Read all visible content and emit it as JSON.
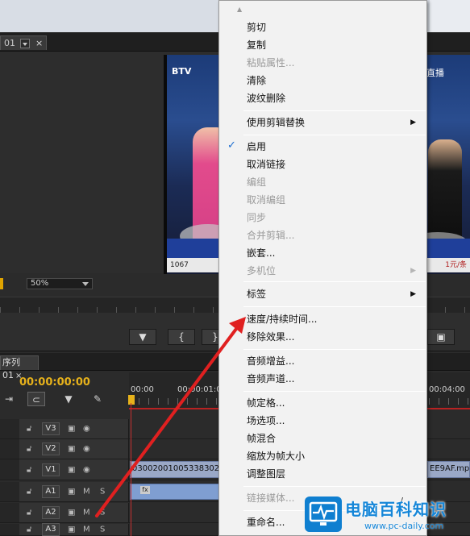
{
  "program_panel": {
    "tab_label": "01",
    "close": "×",
    "zoom_value": "50%"
  },
  "video": {
    "channel_logo": "BTV",
    "live_label": "直播",
    "ticker_left": "1067",
    "ticker_price": "1元/条"
  },
  "transport": {
    "buttons": [
      "▼",
      "{",
      "}"
    ]
  },
  "timeline": {
    "tab_label": "序列 01",
    "tab_close": "×",
    "timecode": "00:00:00:00",
    "ruler_labels": [
      "00:00",
      "00:00:01:00",
      "00:04:00"
    ],
    "tracks": [
      {
        "name": "V3"
      },
      {
        "name": "V2"
      },
      {
        "name": "V1"
      },
      {
        "name": "A1",
        "m": "M",
        "s": "S"
      },
      {
        "name": "A2",
        "m": "M",
        "s": "S"
      },
      {
        "name": "A3",
        "m": "M",
        "s": "S"
      }
    ],
    "clip_v1_left": "03002001005338302B",
    "clip_v1_right": "EE9AF.mp4",
    "fx_badge": "fx"
  },
  "context_menu": {
    "items": [
      {
        "label": "剪切",
        "enabled": true
      },
      {
        "label": "复制",
        "enabled": true
      },
      {
        "label": "粘贴属性...",
        "enabled": false
      },
      {
        "label": "清除",
        "enabled": true
      },
      {
        "label": "波纹删除",
        "enabled": true
      },
      {
        "label": "使用剪辑替换",
        "enabled": true,
        "submenu": true
      },
      {
        "label": "启用",
        "enabled": true,
        "checked": true
      },
      {
        "label": "取消链接",
        "enabled": true
      },
      {
        "label": "编组",
        "enabled": false
      },
      {
        "label": "取消编组",
        "enabled": false
      },
      {
        "label": "同步",
        "enabled": false
      },
      {
        "label": "合并剪辑...",
        "enabled": false
      },
      {
        "label": "嵌套...",
        "enabled": true
      },
      {
        "label": "多机位",
        "enabled": false,
        "submenu": true
      },
      {
        "label": "标签",
        "enabled": true,
        "submenu": true
      },
      {
        "label": "速度/持续时间...",
        "enabled": true
      },
      {
        "label": "移除效果...",
        "enabled": true
      },
      {
        "label": "音频增益...",
        "enabled": true
      },
      {
        "label": "音频声道...",
        "enabled": true
      },
      {
        "label": "帧定格...",
        "enabled": true
      },
      {
        "label": "场选项...",
        "enabled": true
      },
      {
        "label": "帧混合",
        "enabled": true
      },
      {
        "label": "缩放为帧大小",
        "enabled": true
      },
      {
        "label": "调整图层",
        "enabled": true
      },
      {
        "label": "链接媒体...",
        "enabled": false
      },
      {
        "label": "重命名...",
        "enabled": true
      }
    ],
    "check_mark": "✓",
    "submenu_arrow": "▶",
    "scroll_up": "▲"
  },
  "watermark": {
    "title": "电脑百科知识",
    "url": "www.pc-daily.com"
  },
  "colors": {
    "timecode": "#e7b21b",
    "arrow": "#e02020",
    "watermark": "#1586d8"
  }
}
